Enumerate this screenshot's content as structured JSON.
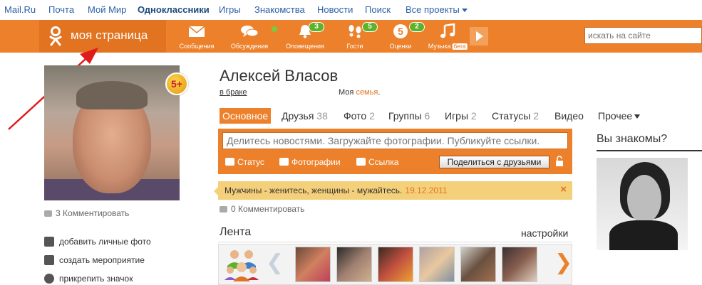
{
  "topbar": {
    "links": [
      "Mail.Ru",
      "Почта",
      "Мой Мир",
      "Одноклассники",
      "Игры",
      "Знакомства",
      "Новости",
      "Поиск",
      "Все проекты"
    ]
  },
  "navbar": {
    "mypage": "моя страница",
    "items": [
      {
        "label": "Сообщения",
        "icon": "envelope-icon",
        "badge": ""
      },
      {
        "label": "Обсуждения",
        "icon": "chat-bubbles-icon",
        "badge": ""
      },
      {
        "label": "Оповещения",
        "icon": "bell-icon",
        "badge": "3"
      },
      {
        "label": "Гости",
        "icon": "footprints-icon",
        "badge": "5"
      },
      {
        "label": "Оценки",
        "icon": "rating-five-icon",
        "badge": "2"
      },
      {
        "label": "Музыка",
        "icon": "music-note-icon",
        "badge": "",
        "tag": "бета"
      }
    ],
    "rating_digit": "5",
    "search_placeholder": "искать на сайте"
  },
  "profile": {
    "name": "Алексей Власов",
    "marital": "в браке",
    "family_prefix": "Моя",
    "family_link": "семья",
    "family_suffix": ".",
    "badge": "5+",
    "comments": "3 Комментировать"
  },
  "left_links": [
    "добавить личные фото",
    "создать мероприятие",
    "прикрепить значок"
  ],
  "tabs": [
    {
      "label": "Основное",
      "count": ""
    },
    {
      "label": "Друзья",
      "count": "38"
    },
    {
      "label": "Фото",
      "count": "2"
    },
    {
      "label": "Группы",
      "count": "6"
    },
    {
      "label": "Игры",
      "count": "2"
    },
    {
      "label": "Статусы",
      "count": "2"
    },
    {
      "label": "Видео",
      "count": ""
    },
    {
      "label": "Прочее",
      "count": ""
    }
  ],
  "share": {
    "placeholder": "Делитесь новостями. Загружайте фотографии. Публикуйте ссылки.",
    "status": "Статус",
    "photos": "Фотографии",
    "link": "Ссылка",
    "share_friends": "Поделиться с друзьями"
  },
  "status_post": {
    "text": "Мужчины - женитесь, женщины - мужайтесь.",
    "date": "19.12.2011",
    "close": "×",
    "comments": "0 Комментировать"
  },
  "feed": {
    "title": "Лента",
    "settings": "настройки",
    "prev": "❮",
    "next": "❯"
  },
  "right": {
    "title": "Вы знакомы?"
  },
  "colors": {
    "orange": "#ed812b",
    "orange_dark": "#e27320",
    "link_blue": "#2b5fa8",
    "badge_green": "#5cb32a",
    "status_yellow": "#f5d07a"
  }
}
